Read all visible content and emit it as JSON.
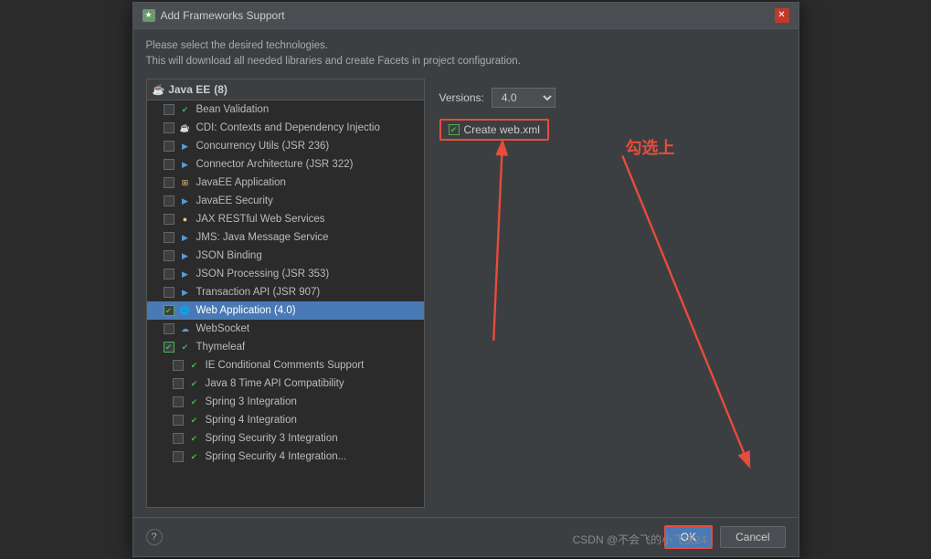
{
  "dialog": {
    "title": "Add Frameworks Support",
    "title_icon": "★",
    "description_line1": "Please select the desired technologies.",
    "description_line2": "This will download all needed libraries and create Facets in project configuration."
  },
  "left_panel": {
    "group_label": "Java EE",
    "group_count": "(8)",
    "items": [
      {
        "label": "Bean Validation",
        "checked": false,
        "icon": "✔",
        "icon_type": "green",
        "sub": false
      },
      {
        "label": "CDI: Contexts and Dependency Injectio",
        "checked": false,
        "icon": "☕",
        "icon_type": "orange",
        "sub": false
      },
      {
        "label": "Concurrency Utils (JSR 236)",
        "checked": false,
        "icon": "▶",
        "icon_type": "blue",
        "sub": false
      },
      {
        "label": "Connector Architecture (JSR 322)",
        "checked": false,
        "icon": "▶",
        "icon_type": "blue",
        "sub": false
      },
      {
        "label": "JavaEE Application",
        "checked": false,
        "icon": "⊞",
        "icon_type": "orange",
        "sub": false
      },
      {
        "label": "JavaEE Security",
        "checked": false,
        "icon": "▶",
        "icon_type": "blue",
        "sub": false
      },
      {
        "label": "JAX RESTful Web Services",
        "checked": false,
        "icon": "●",
        "icon_type": "orange",
        "sub": false
      },
      {
        "label": "JMS: Java Message Service",
        "checked": false,
        "icon": "▶",
        "icon_type": "blue",
        "sub": false
      },
      {
        "label": "JSON Binding",
        "checked": false,
        "icon": "▶",
        "icon_type": "blue",
        "sub": false
      },
      {
        "label": "JSON Processing (JSR 353)",
        "checked": false,
        "icon": "▶",
        "icon_type": "blue",
        "sub": false
      },
      {
        "label": "Transaction API (JSR 907)",
        "checked": false,
        "icon": "▶",
        "icon_type": "blue",
        "sub": false
      },
      {
        "label": "Web Application (4.0)",
        "checked": true,
        "icon": "🌐",
        "icon_type": "blue",
        "sub": false,
        "selected": true
      },
      {
        "label": "WebSocket",
        "checked": false,
        "icon": "☁",
        "icon_type": "blue",
        "sub": false
      },
      {
        "label": "Thymeleaf",
        "checked": true,
        "icon": "✔",
        "icon_type": "green",
        "sub": false
      },
      {
        "label": "IE Conditional Comments Support",
        "checked": false,
        "icon": "✔",
        "icon_type": "green",
        "sub": true
      },
      {
        "label": "Java 8 Time API Compatibility",
        "checked": false,
        "icon": "✔",
        "icon_type": "green",
        "sub": true
      },
      {
        "label": "Spring 3 Integration",
        "checked": false,
        "icon": "✔",
        "icon_type": "green",
        "sub": true
      },
      {
        "label": "Spring 4 Integration",
        "checked": false,
        "icon": "✔",
        "icon_type": "green",
        "sub": true
      },
      {
        "label": "Spring Security 3 Integration",
        "checked": false,
        "icon": "✔",
        "icon_type": "green",
        "sub": true
      },
      {
        "label": "Spring Security 4 Integration",
        "checked": false,
        "icon": "✔",
        "icon_type": "green",
        "sub": true
      }
    ]
  },
  "right_panel": {
    "versions_label": "Versions:",
    "versions_value": "4.0",
    "create_web_xml_label": "Create web.xml",
    "create_web_xml_checked": true,
    "annotation": "勾选上"
  },
  "footer": {
    "help_label": "?",
    "ok_label": "OK",
    "cancel_label": "Cancel"
  },
  "watermark": "CSDN @不会飞的小飞侠24"
}
